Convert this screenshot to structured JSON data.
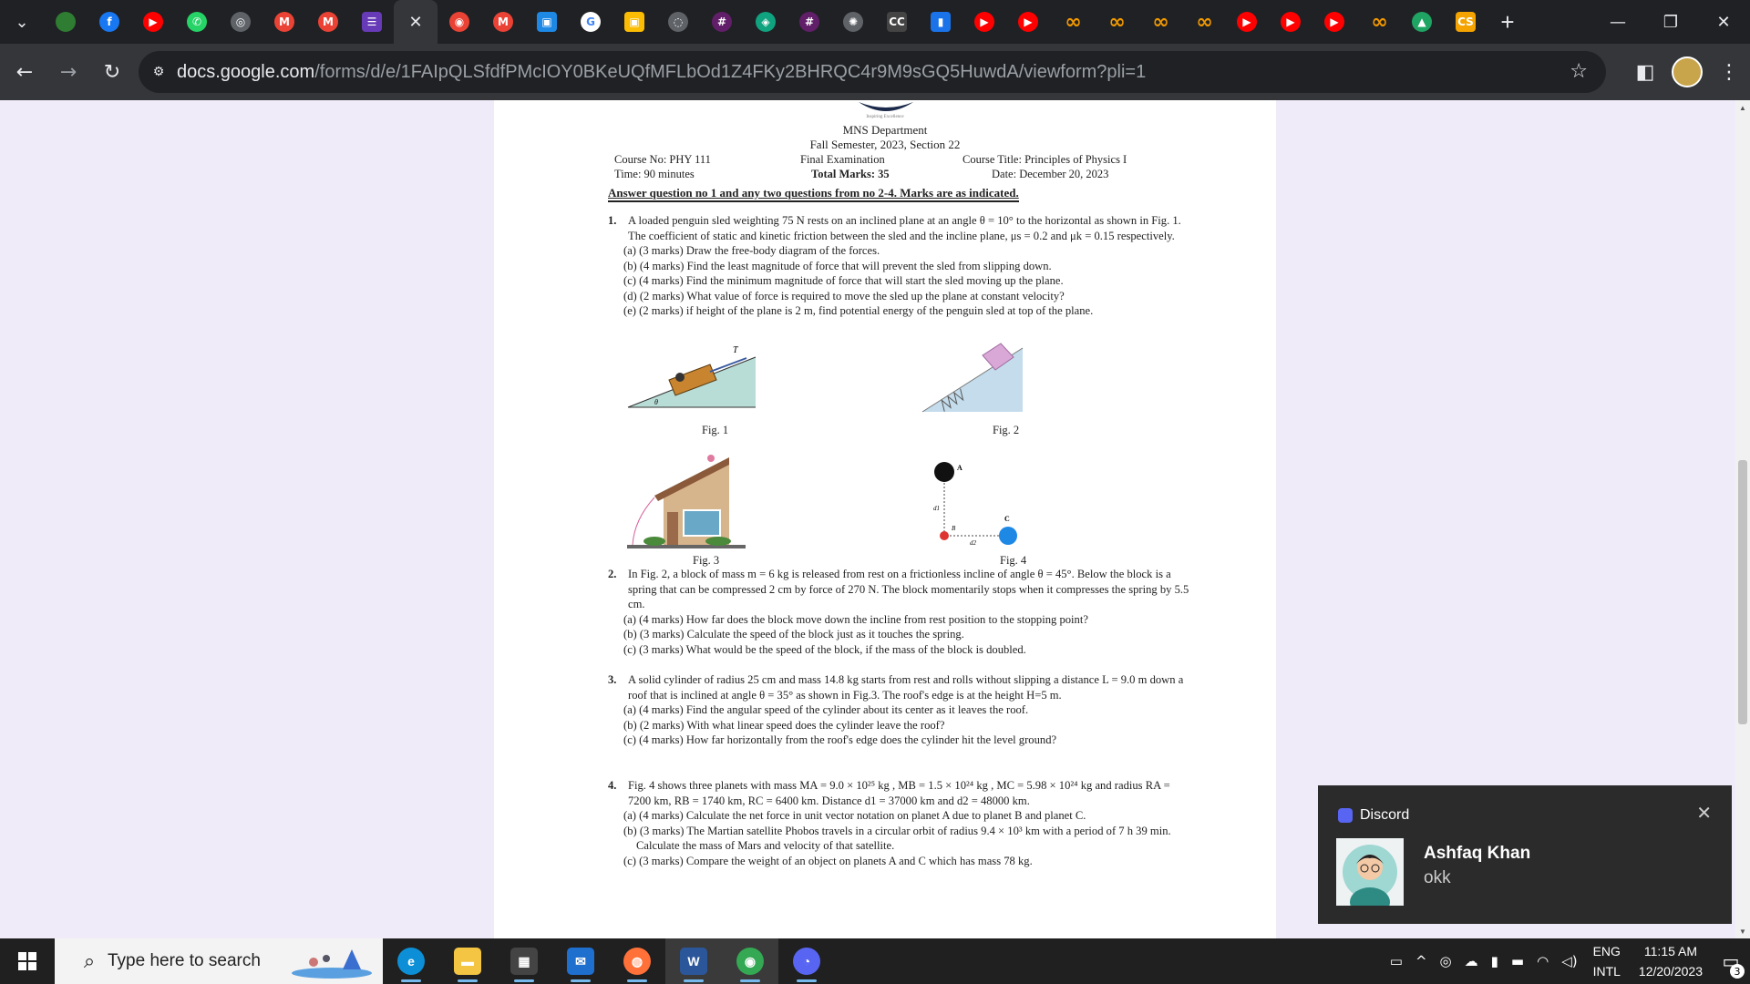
{
  "browser": {
    "tabs": [
      {
        "name": "tab-list",
        "glyph": "⌄",
        "color": "#3c4043"
      },
      {
        "name": "tab-feather",
        "glyph": "",
        "color": "#2e7d32"
      },
      {
        "name": "tab-facebook",
        "glyph": "f",
        "color": "#1877f2"
      },
      {
        "name": "tab-youtube-1",
        "glyph": "▶",
        "color": "#ff0000"
      },
      {
        "name": "tab-whatsapp",
        "glyph": "✆",
        "color": "#25d366"
      },
      {
        "name": "tab-globe",
        "glyph": "◎",
        "color": "#5f6368"
      },
      {
        "name": "tab-gmail-1",
        "glyph": "M",
        "color": "#ea4335"
      },
      {
        "name": "tab-gmail-2",
        "glyph": "M",
        "color": "#ea4335"
      },
      {
        "name": "tab-forms",
        "glyph": "☰",
        "color": "#673ab7"
      },
      {
        "name": "tab-active-close",
        "glyph": "✕",
        "color": "#35363a",
        "active": true
      },
      {
        "name": "tab-record",
        "glyph": "◉",
        "color": "#ea4335"
      },
      {
        "name": "tab-gmail-3",
        "glyph": "M",
        "color": "#ea4335"
      },
      {
        "name": "tab-classroom",
        "glyph": "▣",
        "color": "#1e88e5"
      },
      {
        "name": "tab-google",
        "glyph": "G",
        "color": "#ffffff"
      },
      {
        "name": "tab-classroom-2",
        "glyph": "▣",
        "color": "#fbbc04"
      },
      {
        "name": "tab-chat",
        "glyph": "◌",
        "color": "#5f6368"
      },
      {
        "name": "tab-slack-1",
        "glyph": "#",
        "color": "#611f69"
      },
      {
        "name": "tab-chatgpt",
        "glyph": "◈",
        "color": "#10a37f"
      },
      {
        "name": "tab-slack-2",
        "glyph": "#",
        "color": "#611f69"
      },
      {
        "name": "tab-seal",
        "glyph": "✺",
        "color": "#5f6368"
      },
      {
        "name": "tab-cc",
        "glyph": "CC",
        "color": "#444444"
      },
      {
        "name": "tab-chart",
        "glyph": "▮",
        "color": "#1a73e8"
      },
      {
        "name": "tab-youtube-2",
        "glyph": "▶",
        "color": "#ff0000"
      },
      {
        "name": "tab-youtube-3",
        "glyph": "▶",
        "color": "#ff0000"
      },
      {
        "name": "tab-infinity-1",
        "glyph": "∞",
        "color": "inf"
      },
      {
        "name": "tab-infinity-2",
        "glyph": "∞",
        "color": "inf"
      },
      {
        "name": "tab-infinity-3",
        "glyph": "∞",
        "color": "inf"
      },
      {
        "name": "tab-infinity-4",
        "glyph": "∞",
        "color": "inf"
      },
      {
        "name": "tab-youtube-4",
        "glyph": "▶",
        "color": "#ff0000"
      },
      {
        "name": "tab-youtube-5",
        "glyph": "▶",
        "color": "#ff0000"
      },
      {
        "name": "tab-youtube-6",
        "glyph": "▶",
        "color": "#ff0000"
      },
      {
        "name": "tab-infinity-5",
        "glyph": "∞",
        "color": "inf"
      },
      {
        "name": "tab-drive",
        "glyph": "▲",
        "color": "#1fa463"
      },
      {
        "name": "tab-cs",
        "glyph": "CS",
        "color": "#f4a300"
      }
    ],
    "new_tab_glyph": "+",
    "url_host": "docs.google.com",
    "url_path": "/forms/d/e/1FAIpQLSfdfPMcIOY0BKeUQfMFLbOd1Z4FKy2BHRQC4r9M9sGQ5HuwdA/viewform?pli=1"
  },
  "exam": {
    "logo_tagline": "Inspiring Excellence",
    "department": "MNS Department",
    "semester": "Fall Semester, 2023, Section 22",
    "course_no": "Course No: PHY 111",
    "time": "Time: 90 minutes",
    "exam_type": "Final Examination",
    "total_marks": "Total Marks: 35",
    "course_title": "Course Title: Principles of Physics I",
    "date": "Date: December 20, 2023",
    "instruction": "Answer question no 1 and any two questions from no 2-4. Marks are as indicated.",
    "q1": {
      "num": "1.",
      "body": "A loaded penguin sled weighting 75 N rests on an inclined plane at an angle θ = 10° to the horizontal as shown in Fig. 1. The coefficient of static and kinetic friction between the sled and the incline plane, μs = 0.2 and μk = 0.15 respectively.",
      "a": "(a) (3 marks) Draw the free-body diagram of the forces.",
      "b": "(b) (4 marks) Find the least magnitude of force that will prevent the sled from slipping down.",
      "c": "(c) (4 marks) Find the minimum magnitude of force that will start the sled moving up the plane.",
      "d": "(d) (2 marks) What value of force is required to move the sled up the plane at constant velocity?",
      "e": "(e) (2 marks) if height of the plane is 2 m, find potential energy of the penguin sled at top of the plane."
    },
    "figs": {
      "f1": "Fig. 1",
      "f2": "Fig. 2",
      "f3": "Fig. 3",
      "f4": "Fig. 4",
      "t_label": "T",
      "theta": "θ",
      "a_label": "A",
      "b_label": "B",
      "c_label": "C",
      "d1": "d1",
      "d2": "d2"
    },
    "q2": {
      "num": "2.",
      "body": "In Fig. 2, a block of mass m = 6 kg is released from rest on a frictionless incline of angle θ = 45°. Below the block is a spring that can be compressed 2 cm by force of 270 N. The block momentarily stops when it compresses the spring by 5.5 cm.",
      "a": "(a) (4 marks) How far does the block move down the incline from rest position to the stopping point?",
      "b": "(b) (3 marks) Calculate the speed of the block just as it touches the spring.",
      "c": "(c) (3 marks) What would be the speed of the block, if the mass of the block is doubled."
    },
    "q3": {
      "num": "3.",
      "body": "A solid cylinder of radius 25 cm and mass 14.8 kg starts from rest and rolls without slipping a distance L = 9.0 m down a roof that is inclined at angle θ = 35° as shown in Fig.3. The roof's edge is at the height H=5 m.",
      "a": "(a) (4 marks) Find the angular speed of the cylinder about its center as it leaves the roof.",
      "b": "(b) (2 marks) With what linear speed does the cylinder leave the roof?",
      "c": "(c) (4 marks) How far horizontally from the roof's edge does the cylinder hit the level ground?"
    },
    "q4": {
      "num": "4.",
      "body": "Fig. 4 shows three planets with mass MA = 9.0 × 10²⁵ kg , MB = 1.5 × 10²⁴ kg , MC = 5.98 × 10²⁴ kg and radius RA = 7200 km, RB = 1740 km, RC = 6400 km. Distance d1 = 37000 km and d2 = 48000 km.",
      "a": "(a) (4 marks) Calculate the net force in unit vector notation on planet A due to planet B and planet C.",
      "b": "(b) (3 marks) The Martian satellite Phobos travels in a circular orbit of radius 9.4 × 10³ km with a period of 7 h 39 min. Calculate the mass of Mars and velocity of that satellite.",
      "c": "(c) (3 marks) Compare the weight of an object on planets A and C which has mass 78 kg."
    }
  },
  "notification": {
    "app": "Discord",
    "sender": "Ashfaq Khan",
    "message": "okk"
  },
  "taskbar": {
    "search_placeholder": "Type here to search",
    "apps": [
      {
        "name": "taskbar-edge",
        "glyph": "e",
        "color": "#0c8fd6"
      },
      {
        "name": "taskbar-file-explorer",
        "glyph": "▬",
        "color": "#f4c542"
      },
      {
        "name": "taskbar-store",
        "glyph": "▦",
        "color": "#444444"
      },
      {
        "name": "taskbar-mail",
        "glyph": "✉",
        "color": "#1f6fcf"
      },
      {
        "name": "taskbar-firefox",
        "glyph": "◍",
        "color": "#ff7139"
      },
      {
        "name": "taskbar-word",
        "glyph": "W",
        "color": "#2b579a"
      },
      {
        "name": "taskbar-chrome",
        "glyph": "◉",
        "color": "#34a853"
      },
      {
        "name": "taskbar-discord",
        "glyph": "◔",
        "color": "#5865f2"
      }
    ],
    "lang_top": "ENG",
    "lang_bottom": "INTL",
    "time": "11:15 AM",
    "date": "12/20/2023",
    "notification_count": "3"
  }
}
